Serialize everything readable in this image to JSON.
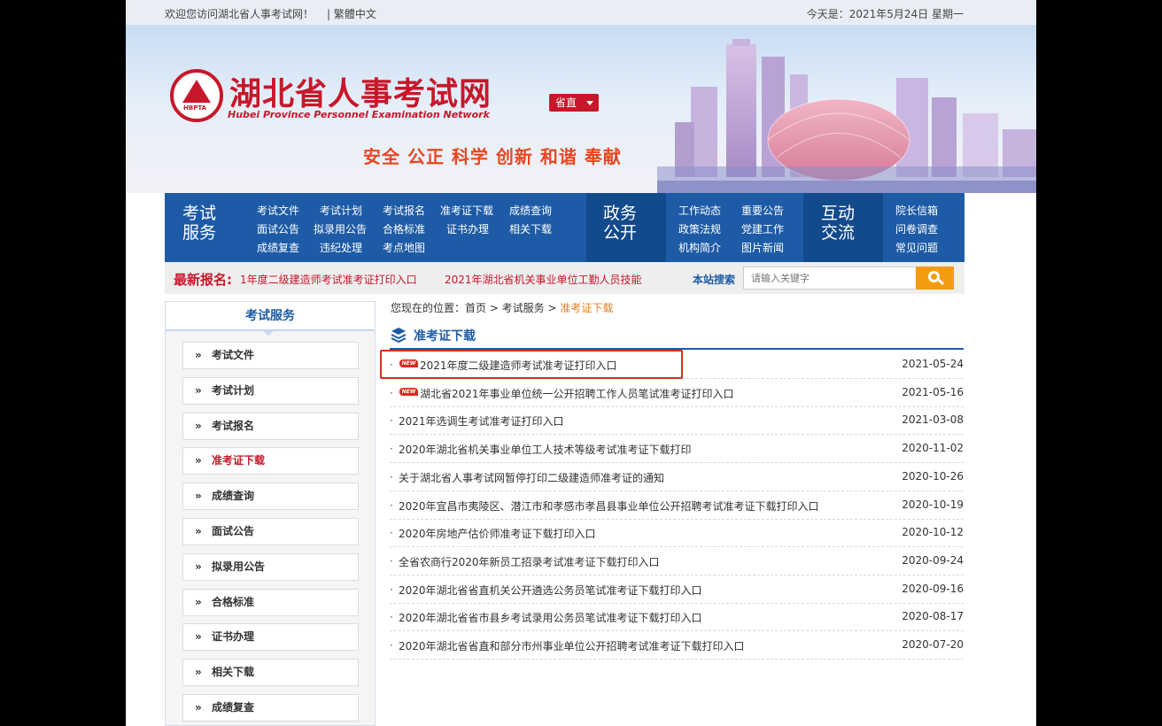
{
  "topbar": {
    "welcome": "欢迎您访问湖北省人事考试网！",
    "traditional": "| 繁體中文",
    "date": "今天是：2021年5月24日 星期一"
  },
  "header": {
    "logo_tag": "HBPTA",
    "site_title": "湖北省人事考试网",
    "site_subtitle": "Hubei Province Personnel Examination Network",
    "region_button": "省直",
    "slogan": "安全 公正 科学 创新 和谐 奉献"
  },
  "nav": {
    "exam_service": {
      "title": "考试服务",
      "links": [
        "考试文件",
        "考试计划",
        "考试报名",
        "准考证下载",
        "成绩查询",
        "面试公告",
        "拟录用公告",
        "合格标准",
        "证书办理",
        "相关下载",
        "成绩复查",
        "违纪处理",
        "考点地图"
      ]
    },
    "government": {
      "title": "政务公开",
      "links": [
        "工作动态",
        "重要公告",
        "政策法规",
        "党建工作",
        "机构简介",
        "图片新闻"
      ]
    },
    "interact": {
      "title": "互动交流",
      "links": [
        "院长信箱",
        "问卷调查",
        "常见问题"
      ]
    }
  },
  "ticker": {
    "label": "最新报名:",
    "items": [
      "1年度二级建造师考试准考证打印入口",
      "2021年湖北省机关事业单位工勤人员技能"
    ],
    "search_label": "本站搜索",
    "search_placeholder": "请输入关键字"
  },
  "sidebar": {
    "heading": "考试服务",
    "items": [
      "考试文件",
      "考试计划",
      "考试报名",
      "准考证下载",
      "成绩查询",
      "面试公告",
      "拟录用公告",
      "合格标准",
      "证书办理",
      "相关下载",
      "成绩复查"
    ],
    "active_item": "准考证下载"
  },
  "breadcrumb": {
    "prefix": "您现在的位置：首页 > 考试服务 > ",
    "current": "准考证下载"
  },
  "section_title": "准考证下载",
  "list": [
    {
      "title": "2021年度二级建造师考试准考证打印入口",
      "date": "2021-05-24",
      "new": true
    },
    {
      "title": "湖北省2021年事业单位统一公开招聘工作人员笔试准考证打印入口",
      "date": "2021-05-16",
      "new": true
    },
    {
      "title": "2021年选调生考试准考证打印入口",
      "date": "2021-03-08",
      "new": false
    },
    {
      "title": "2020年湖北省机关事业单位工人技术等级考试准考证下载打印",
      "date": "2020-11-02",
      "new": false
    },
    {
      "title": "关于湖北省人事考试网暂停打印二级建造师准考证的通知",
      "date": "2020-10-26",
      "new": false
    },
    {
      "title": "2020年宜昌市夷陵区、潜江市和孝感市孝昌县事业单位公开招聘考试准考证下载打印入口",
      "date": "2020-10-19",
      "new": false
    },
    {
      "title": "2020年房地产估价师准考证下载打印入口",
      "date": "2020-10-12",
      "new": false
    },
    {
      "title": "全省农商行2020年新员工招录考试准考证下载打印入口",
      "date": "2020-09-24",
      "new": false
    },
    {
      "title": "2020年湖北省省直机关公开遴选公务员笔试准考证下载打印入口",
      "date": "2020-09-16",
      "new": false
    },
    {
      "title": "2020年湖北省省市县乡考试录用公务员笔试准考证下载打印入口",
      "date": "2020-08-17",
      "new": false
    },
    {
      "title": "2020年湖北省省直和部分市州事业单位公开招聘考试准考证下载打印入口",
      "date": "2020-07-20",
      "new": false
    }
  ],
  "new_badge": "NEW",
  "bullet": "·",
  "side_arrow": "»",
  "colors": {
    "brand_red": "#c8172a",
    "nav_blue": "#1d5ba6",
    "accent_orange": "#f39c12",
    "highlight": "#d62d20"
  }
}
